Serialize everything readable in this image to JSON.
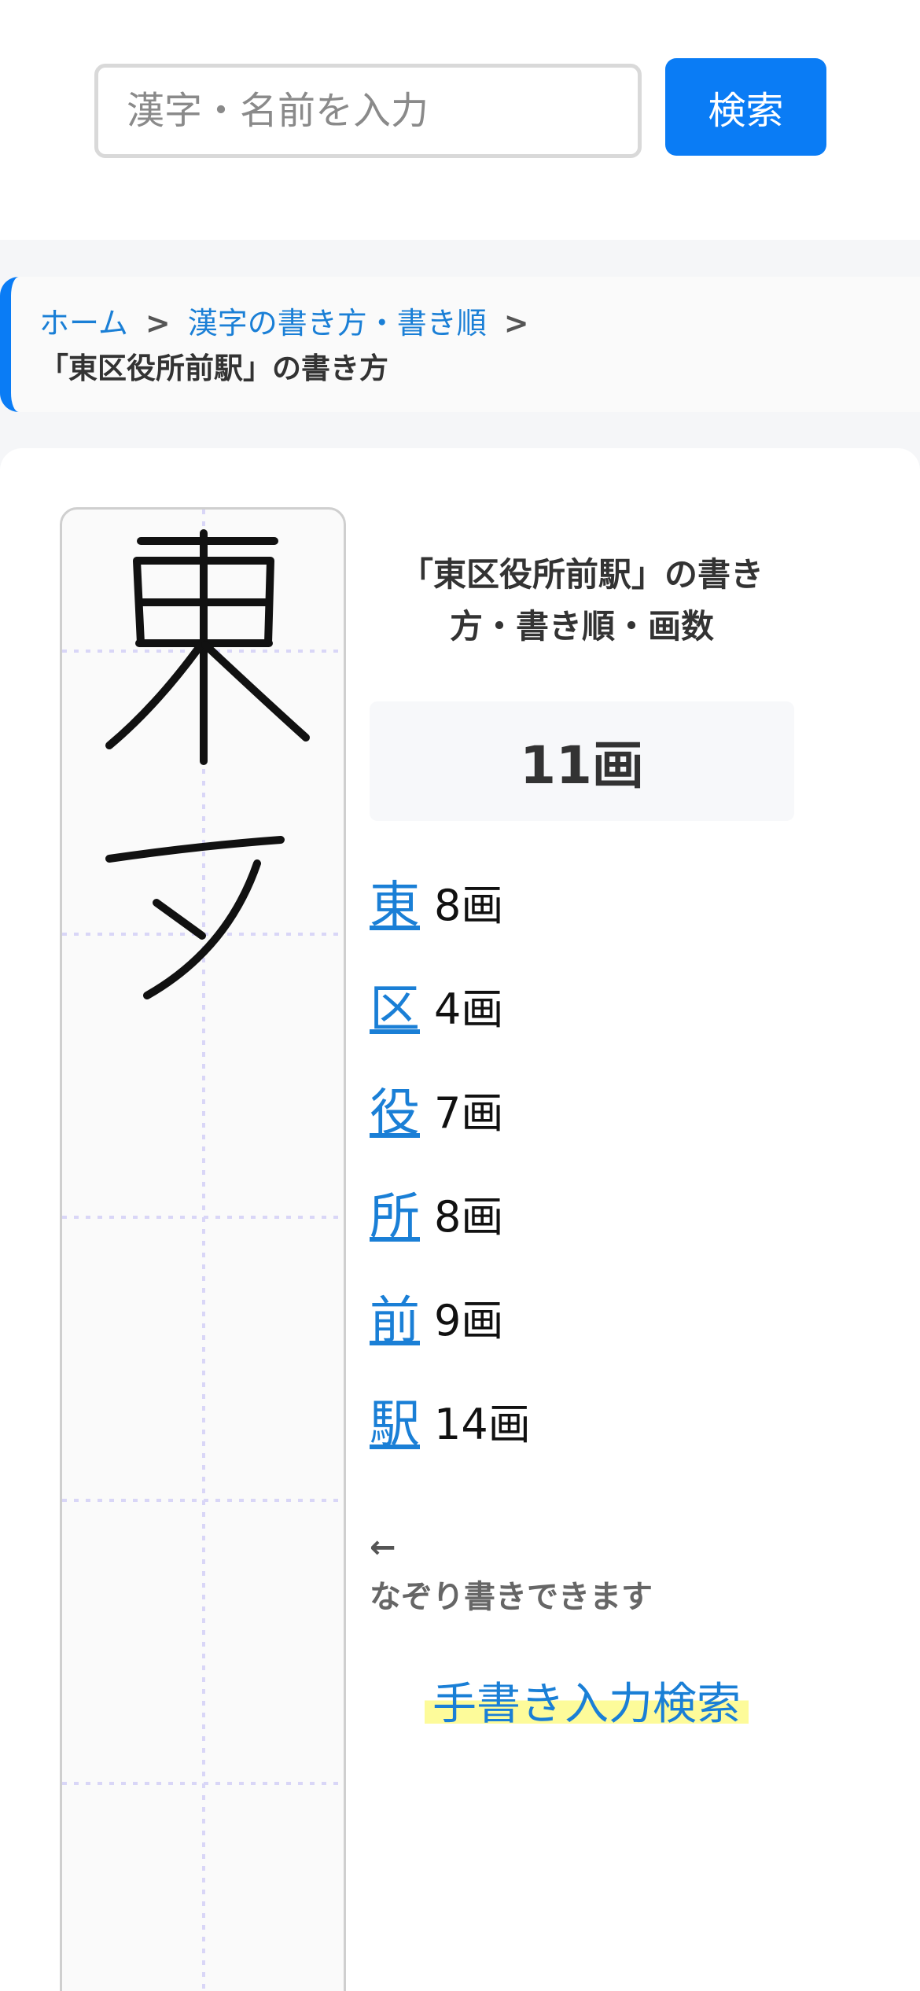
{
  "search": {
    "placeholder": "漢字・名前を入力",
    "button_label": "検索"
  },
  "breadcrumb": {
    "home": "ホーム",
    "separator": ">",
    "category": "漢字の書き方・書き順",
    "current": "「東区役所前駅」の書き方"
  },
  "writing_box": {
    "characters": [
      "東",
      "ヲ"
    ]
  },
  "info": {
    "title": "「東区役所前駅」の書き方・書き順・画数",
    "total_strokes": "11画",
    "characters": [
      {
        "kanji": "東",
        "strokes": "8画"
      },
      {
        "kanji": "区",
        "strokes": "4画"
      },
      {
        "kanji": "役",
        "strokes": "7画"
      },
      {
        "kanji": "所",
        "strokes": "8画"
      },
      {
        "kanji": "前",
        "strokes": "9画"
      },
      {
        "kanji": "駅",
        "strokes": "14画"
      }
    ],
    "trace_arrow": "←",
    "trace_note": "なぞり書きできます",
    "handwrite_link": "手書き入力検索"
  },
  "colors": {
    "accent": "#0a7cf5",
    "link": "#1a7fd6",
    "highlight": "#fdfb9a"
  }
}
